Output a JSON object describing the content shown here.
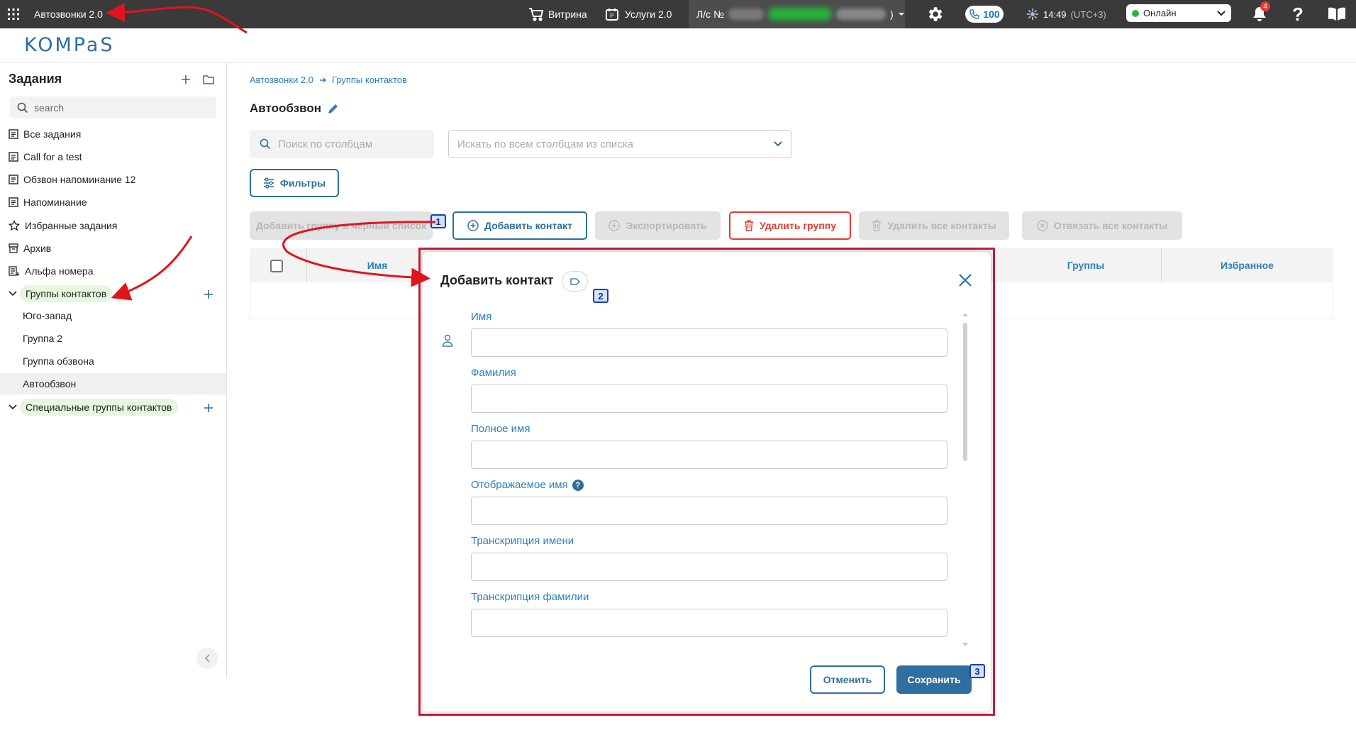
{
  "topbar": {
    "app_title": "Автозвонки 2.0",
    "showcase": "Витрина",
    "services": "Услуги 2.0",
    "account_prefix": "Л/с №",
    "account_suffix": ")",
    "calls_count": "100",
    "time": "14:49",
    "timezone": "(UTC+3)",
    "status": "Онлайн",
    "notifications_count": "4"
  },
  "logo": {
    "text": "KOMPaS"
  },
  "sidebar": {
    "title": "Задания",
    "search_placeholder": "search",
    "items": [
      {
        "label": "Все задания",
        "icon": "list-icon"
      },
      {
        "label": "Call for a test",
        "icon": "list-icon"
      },
      {
        "label": "Обзвон напоминание 12",
        "icon": "list-icon"
      },
      {
        "label": "Напоминание",
        "icon": "list-icon"
      },
      {
        "label": "Избранные задания",
        "icon": "star-icon"
      },
      {
        "label": "Архив",
        "icon": "archive-icon"
      },
      {
        "label": "Альфа номера",
        "icon": "alpha-numbers-icon"
      }
    ],
    "contact_groups": {
      "label": "Группы контактов",
      "children": [
        "Юго-запад",
        "Группа 2",
        "Группа обзвона",
        "Автообзвон"
      ],
      "active_child": "Автообзвон"
    },
    "special_groups": {
      "label": "Специальные группы контактов"
    }
  },
  "breadcrumb": [
    "Автозвонки 2.0",
    "Группы контактов"
  ],
  "content": {
    "title": "Автообзвон",
    "column_search_placeholder": "Поиск по столбцам",
    "all_columns_placeholder": "Искать по всем столбцам из списка",
    "filters_label": "Фильтры"
  },
  "actions": {
    "add_to_blacklist": "Добавить группу в черный список",
    "add_contact": "Добавить контакт",
    "export": "Экспортировать",
    "delete_group": "Удалить группу",
    "delete_all_contacts": "Удалить все контакты",
    "unlink_all_contacts": "Отвязать все контакты"
  },
  "table": {
    "columns": [
      "Имя",
      "Группы",
      "Избранное"
    ]
  },
  "dialog": {
    "title": "Добавить контакт",
    "fields": [
      {
        "label": "Имя",
        "value": ""
      },
      {
        "label": "Фамилия",
        "value": ""
      },
      {
        "label": "Полное имя",
        "value": ""
      },
      {
        "label": "Отображаемое имя",
        "value": "",
        "help": "?"
      },
      {
        "label": "Транскрипция имени",
        "value": ""
      },
      {
        "label": "Транскрипция фамилии",
        "value": ""
      }
    ],
    "cancel_label": "Отменить",
    "save_label": "Сохранить"
  },
  "annotations": {
    "steps": [
      "1",
      "2",
      "3"
    ],
    "arrow_color": "#e0141c",
    "frame_color": "#c21d39"
  },
  "colors": {
    "primary": "#2f6e9e",
    "link": "#2d7fbf",
    "danger": "#e53935",
    "online": "#2fb344"
  }
}
